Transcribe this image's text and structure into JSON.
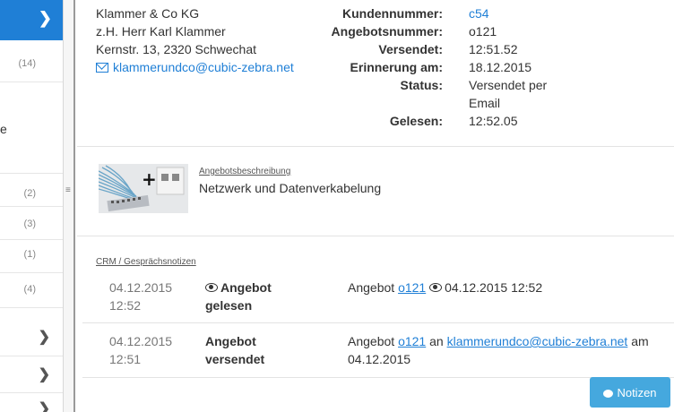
{
  "sidebar": {
    "counts": [
      "(14)",
      "(2)",
      "(3)",
      "(1)",
      "(4)"
    ],
    "partial_label": "e"
  },
  "customer": {
    "company": "Klammer & Co KG",
    "contact": "z.H. Herr Karl Klammer",
    "address": "Kernstr. 13, 2320 Schwechat",
    "email": "klammerundco@cubic-zebra.net"
  },
  "meta": {
    "kundennummer_label": "Kundennummer:",
    "kundennummer": "c54",
    "angebotsnummer_label": "Angebotsnummer:",
    "angebotsnummer": "o121",
    "versendet_label": "Versendet:",
    "versendet": "12:51.52",
    "erinnerung_label": "Erinnerung am:",
    "erinnerung": "18.12.2015",
    "status_label": "Status:",
    "status_line1": "Versendet per",
    "status_line2": "Email",
    "gelesen_label": "Gelesen:",
    "gelesen": "12:52.05"
  },
  "offer": {
    "description_label": "Angebotsbeschreibung",
    "description": "Netzwerk und Datenverkabelung"
  },
  "crm": {
    "label": "CRM / Gesprächsnotizen",
    "entries": [
      {
        "date": "04.12.2015",
        "time": "12:52",
        "title_line1": "Angebot",
        "title_line2": "gelesen",
        "text_prefix": "Angebot ",
        "offer_link": "o121",
        "text_suffix": "04.12.2015 12:52"
      },
      {
        "date": "04.12.2015",
        "time": "12:51",
        "title_line1": "Angebot",
        "title_line2": "versendet",
        "text_prefix": "Angebot ",
        "offer_link": "o121",
        "text_middle": " an ",
        "email_link": "klammerundco@cubic-zebra.net",
        "text_suffix": " am",
        "text_line2": "04.12.2015"
      }
    ]
  },
  "notes_button": "Notizen",
  "colors": {
    "accent": "#1f7fd6",
    "notes_button": "#45a8de"
  }
}
